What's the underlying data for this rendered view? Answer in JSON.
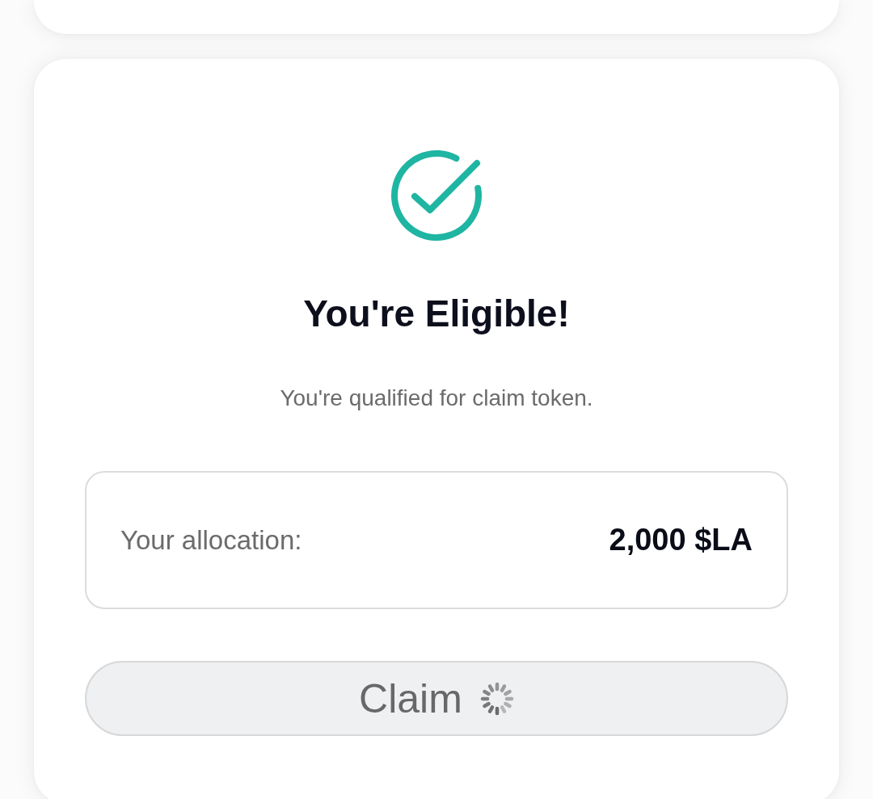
{
  "title": "You're Eligible!",
  "subtitle": "You're qualified for claim token.",
  "allocation": {
    "label": "Your allocation:",
    "value": "2,000 $LA"
  },
  "claim_button": {
    "label": "Claim",
    "loading": true,
    "disabled": true
  }
}
